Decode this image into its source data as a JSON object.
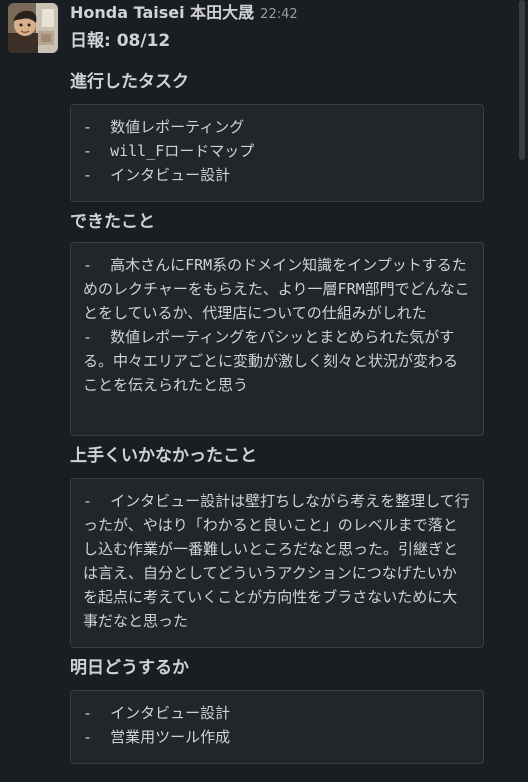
{
  "message": {
    "sender_name": "Honda Taisei 本田大晟",
    "timestamp": "22:42",
    "title": "日報: 08/12"
  },
  "sections": [
    {
      "heading": "進行したタスク",
      "body": "-  数値レポーティング\n-  will_Fロードマップ\n-  インタビュー設計"
    },
    {
      "heading": "できたこと",
      "body": "-  高木さんにFRM系のドメイン知識をインプットするためのレクチャーをもらえた、より一層FRM部門でどんなことをしているか、代理店についての仕組みがしれた\n-  数値レポーティングをパシッとまとめられた気がする。中々エリアごとに変動が激しく刻々と状況が変わることを伝えられたと思う"
    },
    {
      "heading": "上手くいかなかったこと",
      "body": "-  インタビュー設計は壁打ちしながら考えを整理して行ったが、やはり「わかると良いこと」のレベルまで落とし込む作業が一番難しいところだなと思った。引継ぎとは言え、自分としてどういうアクションにつなげたいかを起点に考えていくことが方向性をブラさないために大事だなと思った"
    },
    {
      "heading": "明日どうするか",
      "body": "-  インタビュー設計\n-  営業用ツール作成"
    }
  ]
}
